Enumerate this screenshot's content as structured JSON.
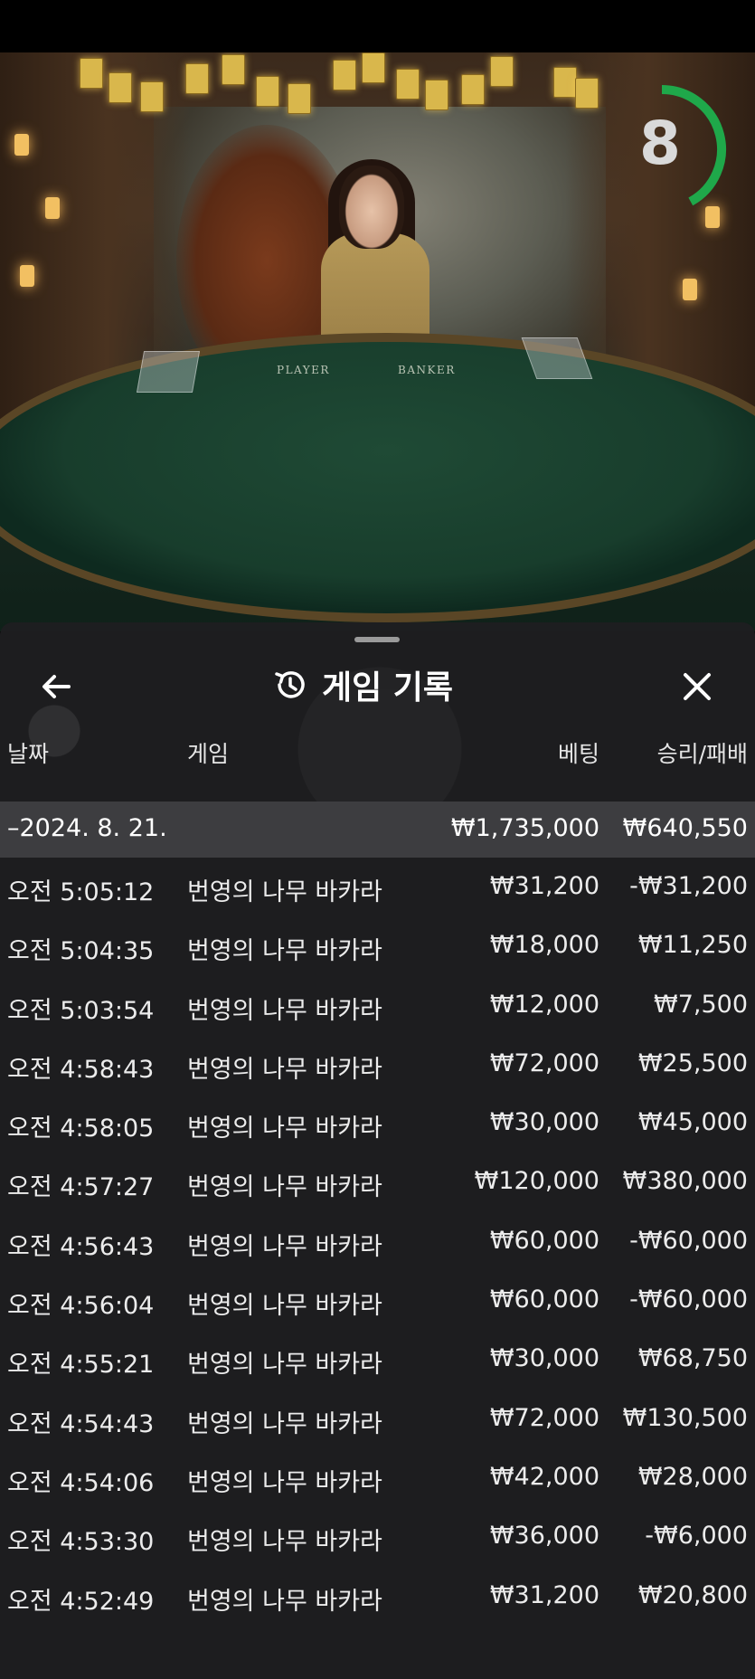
{
  "timer": {
    "value": "8",
    "fraction": 0.3,
    "color": "#1fa84a"
  },
  "table": {
    "player_label": "PLAYER",
    "banker_label": "BANKER"
  },
  "sheet": {
    "title": "게임 기록",
    "history_icon": "history-clock-icon",
    "back_icon": "arrow-left-icon",
    "close_icon": "close-icon"
  },
  "columns": {
    "date": "날짜",
    "game": "게임",
    "bet": "베팅",
    "result": "승리/패배"
  },
  "day": {
    "date": "–2024. 8. 21.",
    "bet_total": "₩1,735,000",
    "result_total": "₩640,550"
  },
  "rows": [
    {
      "time": "오전 5:05:12",
      "game": "번영의 나무 바카라",
      "bet": "₩31,200",
      "result": "-₩31,200"
    },
    {
      "time": "오전 5:04:35",
      "game": "번영의 나무 바카라",
      "bet": "₩18,000",
      "result": "₩11,250"
    },
    {
      "time": "오전 5:03:54",
      "game": "번영의 나무 바카라",
      "bet": "₩12,000",
      "result": "₩7,500"
    },
    {
      "time": "오전 4:58:43",
      "game": "번영의 나무 바카라",
      "bet": "₩72,000",
      "result": "₩25,500"
    },
    {
      "time": "오전 4:58:05",
      "game": "번영의 나무 바카라",
      "bet": "₩30,000",
      "result": "₩45,000"
    },
    {
      "time": "오전 4:57:27",
      "game": "번영의 나무 바카라",
      "bet": "₩120,000",
      "result": "₩380,000"
    },
    {
      "time": "오전 4:56:43",
      "game": "번영의 나무 바카라",
      "bet": "₩60,000",
      "result": "-₩60,000"
    },
    {
      "time": "오전 4:56:04",
      "game": "번영의 나무 바카라",
      "bet": "₩60,000",
      "result": "-₩60,000"
    },
    {
      "time": "오전 4:55:21",
      "game": "번영의 나무 바카라",
      "bet": "₩30,000",
      "result": "₩68,750"
    },
    {
      "time": "오전 4:54:43",
      "game": "번영의 나무 바카라",
      "bet": "₩72,000",
      "result": "₩130,500"
    },
    {
      "time": "오전 4:54:06",
      "game": "번영의 나무 바카라",
      "bet": "₩42,000",
      "result": "₩28,000"
    },
    {
      "time": "오전 4:53:30",
      "game": "번영의 나무 바카라",
      "bet": "₩36,000",
      "result": "-₩6,000"
    },
    {
      "time": "오전 4:52:49",
      "game": "번영의 나무 바카라",
      "bet": "₩31,200",
      "result": "₩20,800"
    }
  ]
}
